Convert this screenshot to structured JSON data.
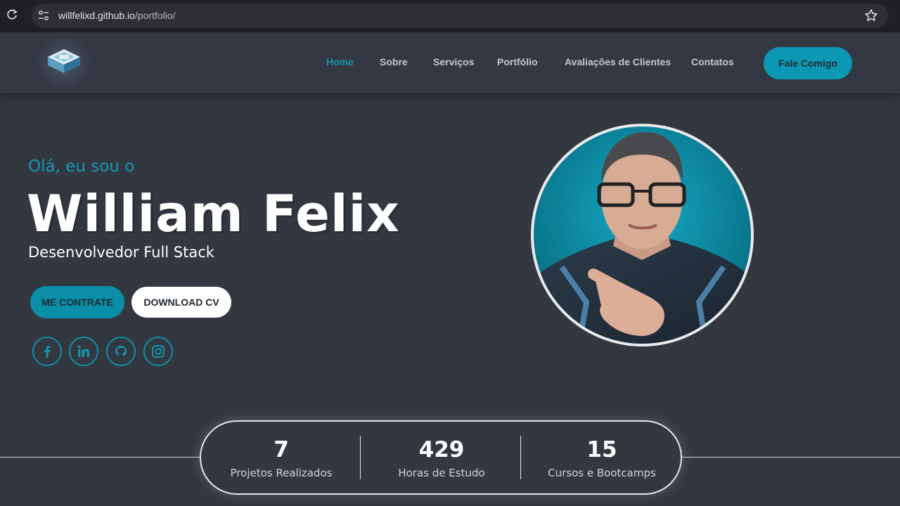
{
  "browser": {
    "url_domain": "willfelixd.github.io",
    "url_path": "/portfolio/",
    "icons": [
      "reload-icon",
      "site-info-icon",
      "bookmark-star-icon"
    ]
  },
  "header": {
    "nav": [
      {
        "label": "Home",
        "active": true
      },
      {
        "label": "Sobre",
        "active": false
      },
      {
        "label": "Serviços",
        "active": false
      },
      {
        "label": "Portfólio",
        "active": false
      },
      {
        "label": "Avaliações de Clientes",
        "active": false
      },
      {
        "label": "Contatos",
        "active": false
      }
    ],
    "cta_label": "Fale Comigo"
  },
  "hero": {
    "greeting": "Olá, eu sou o",
    "name": "William Felix",
    "role": "Desenvolvedor Full Stack",
    "hire_label": "ME CONTRATE",
    "cv_label": "DOWNLOAD CV",
    "social_icons": [
      "facebook-icon",
      "linkedin-icon",
      "github-icon",
      "instagram-icon"
    ]
  },
  "stats": [
    {
      "number": "7",
      "label": "Projetos Realizados"
    },
    {
      "number": "429",
      "label": "Horas de Estudo"
    },
    {
      "number": "15",
      "label": "Cursos e Bootcamps"
    }
  ],
  "colors": {
    "accent": "#0c98b4",
    "background": "#333740",
    "header": "#343843"
  }
}
